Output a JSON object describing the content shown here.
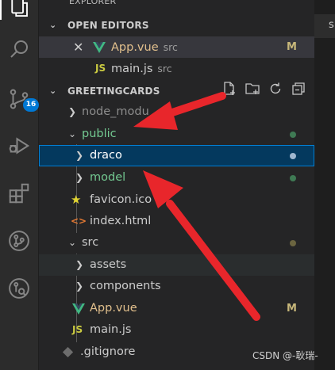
{
  "explorer_title_partial": "EXPLORER",
  "open_editors": {
    "title": "OPEN EDITORS",
    "files": [
      {
        "name": "App.vue",
        "folder": "src",
        "status": "M",
        "icon": "vue-icon"
      },
      {
        "name": "main.js",
        "folder": "src",
        "status": "",
        "icon": "js-icon"
      }
    ]
  },
  "project": {
    "title": "GREETINGCARDS",
    "tree": [
      {
        "name": "node_modu",
        "type": "folder",
        "state": "collapsed"
      },
      {
        "name": "public",
        "type": "folder",
        "state": "expanded",
        "color": "#73c991"
      },
      {
        "name": "draco",
        "type": "folder",
        "state": "collapsed",
        "selected": true
      },
      {
        "name": "model",
        "type": "folder",
        "state": "collapsed",
        "color": "#73c991"
      },
      {
        "name": "favicon.ico",
        "type": "file",
        "icon": "star-icon"
      },
      {
        "name": "index.html",
        "type": "file",
        "icon": "html-icon"
      },
      {
        "name": "src",
        "type": "folder",
        "state": "expanded"
      },
      {
        "name": "assets",
        "type": "folder",
        "state": "collapsed"
      },
      {
        "name": "components",
        "type": "folder",
        "state": "collapsed"
      },
      {
        "name": "App.vue",
        "type": "file",
        "icon": "vue-icon",
        "status": "M",
        "color": "#e2c08d"
      },
      {
        "name": "main.js",
        "type": "file",
        "icon": "js-icon"
      },
      {
        "name": ".gitignore",
        "type": "file",
        "icon": "git-icon"
      }
    ]
  },
  "source_control_badge": "16",
  "editor_tab_partial": "s",
  "watermark": "CSDN @-耿瑞-",
  "colors": {
    "accent": "#0078d4",
    "selection_bg": "#04395e",
    "selection_border": "#007fd4",
    "untracked_green": "#73c991",
    "modified_yellow": "#e2c08d",
    "vue_green": "#41b883",
    "js_yellow": "#cbcb41",
    "html_orange": "#e37933",
    "arrow_red": "#e8262b"
  }
}
